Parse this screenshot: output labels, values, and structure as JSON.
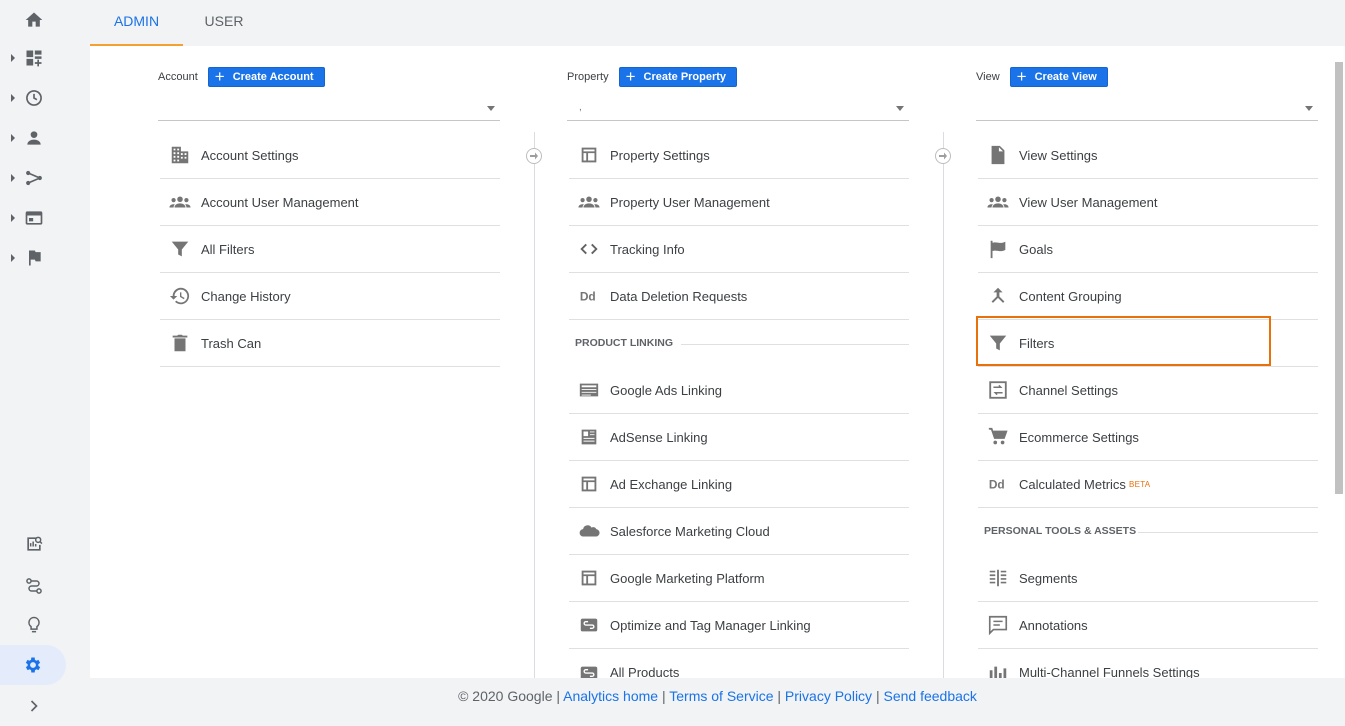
{
  "tabs": [
    {
      "label": "ADMIN",
      "active": true
    },
    {
      "label": "USER",
      "active": false
    }
  ],
  "nav_icons": [
    "home-icon",
    "dashboard-icon",
    "clock-icon",
    "person-icon",
    "acquisition-icon",
    "behavior-icon",
    "flag-icon",
    "insights-search-icon",
    "attribution-icon",
    "lightbulb-icon",
    "gear-icon",
    "chevron-right-icon"
  ],
  "account": {
    "label": "Account",
    "create_label": "Create Account",
    "items": [
      {
        "label": "Account Settings",
        "icon": "building-icon"
      },
      {
        "label": "Account User Management",
        "icon": "people-icon"
      },
      {
        "label": "All Filters",
        "icon": "filter-icon"
      },
      {
        "label": "Change History",
        "icon": "history-icon"
      },
      {
        "label": "Trash Can",
        "icon": "trash-icon"
      }
    ]
  },
  "property": {
    "label": "Property",
    "create_label": "Create Property",
    "selected_value": ",",
    "items": [
      {
        "label": "Property Settings",
        "icon": "window-icon"
      },
      {
        "label": "Property User Management",
        "icon": "people-icon"
      },
      {
        "label": "Tracking Info",
        "icon": "code-icon"
      },
      {
        "label": "Data Deletion Requests",
        "icon": "dd-icon"
      }
    ],
    "section_title": "PRODUCT LINKING",
    "linking_items": [
      {
        "label": "Google Ads Linking",
        "icon": "ads-icon"
      },
      {
        "label": "AdSense Linking",
        "icon": "adsense-icon"
      },
      {
        "label": "Ad Exchange Linking",
        "icon": "window-icon"
      },
      {
        "label": "Salesforce Marketing Cloud",
        "icon": "cloud-icon"
      },
      {
        "label": "Google Marketing Platform",
        "icon": "window-icon"
      },
      {
        "label": "Optimize and Tag Manager Linking",
        "icon": "link-icon"
      },
      {
        "label": "All Products",
        "icon": "link-icon"
      }
    ]
  },
  "view": {
    "label": "View",
    "create_label": "Create View",
    "items": [
      {
        "label": "View Settings",
        "icon": "document-icon"
      },
      {
        "label": "View User Management",
        "icon": "people-icon"
      },
      {
        "label": "Goals",
        "icon": "flag-icon"
      },
      {
        "label": "Content Grouping",
        "icon": "merge-icon"
      },
      {
        "label": "Filters",
        "icon": "filter-icon"
      },
      {
        "label": "Channel Settings",
        "icon": "channel-icon"
      },
      {
        "label": "Ecommerce Settings",
        "icon": "cart-icon"
      },
      {
        "label": "Calculated Metrics",
        "icon": "dd-icon",
        "badge": "BETA"
      }
    ],
    "section_title": "PERSONAL TOOLS & ASSETS",
    "tools_items": [
      {
        "label": "Segments",
        "icon": "segments-icon"
      },
      {
        "label": "Annotations",
        "icon": "comment-icon"
      },
      {
        "label": "Multi-Channel Funnels Settings",
        "icon": "bars-icon"
      }
    ]
  },
  "footer": {
    "copyright": "© 2020 Google",
    "links": [
      "Analytics home",
      "Terms of Service",
      "Privacy Policy",
      "Send feedback"
    ],
    "separator": "|"
  },
  "colors": {
    "accent": "#1a73e8",
    "highlight": "#e8710a",
    "tab_underline": "#f4a033"
  }
}
